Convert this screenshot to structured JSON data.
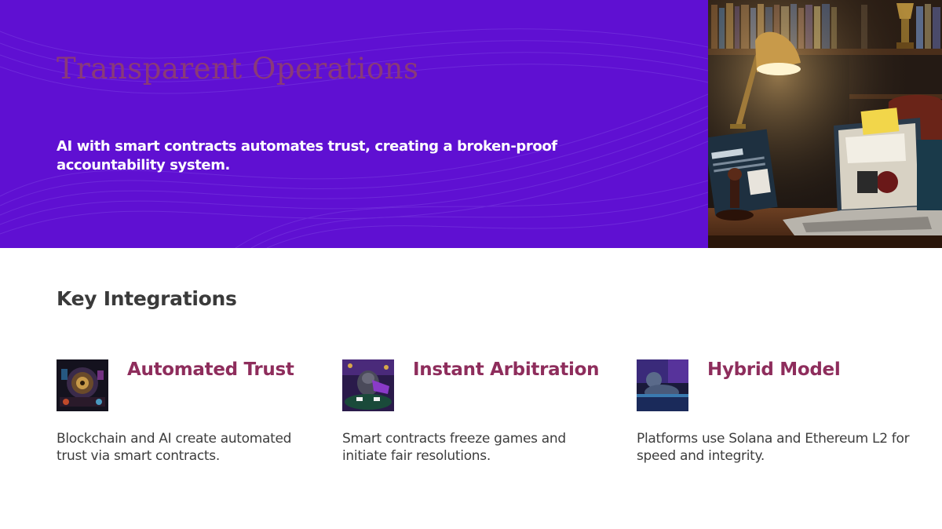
{
  "hero": {
    "title": "Transparent Operations",
    "subtitle": "AI with smart contracts automates trust, creating a broken-proof accountability system.",
    "background_color": "#5f10d2",
    "title_color": "#8a3a78"
  },
  "photo": {
    "note_text": "Key Legal",
    "document_text": "CURAÇAO",
    "description_icon": "desk-lamp-laptop-icon"
  },
  "section": {
    "title": "Key Integrations"
  },
  "cards": [
    {
      "title": "Automated Trust",
      "description": "Blockchain and AI create automated trust via smart contracts.",
      "image_icon": "vault-icon"
    },
    {
      "title": "Instant Arbitration",
      "description": "Smart contracts freeze games and initiate fair resolutions.",
      "image_icon": "gorilla-poker-icon"
    },
    {
      "title": "Hybrid Model",
      "description": "Platforms use Solana and Ethereum L2 for speed and integrity.",
      "image_icon": "gorilla-lounge-icon"
    }
  ],
  "accent_color": "#8e2d5c"
}
